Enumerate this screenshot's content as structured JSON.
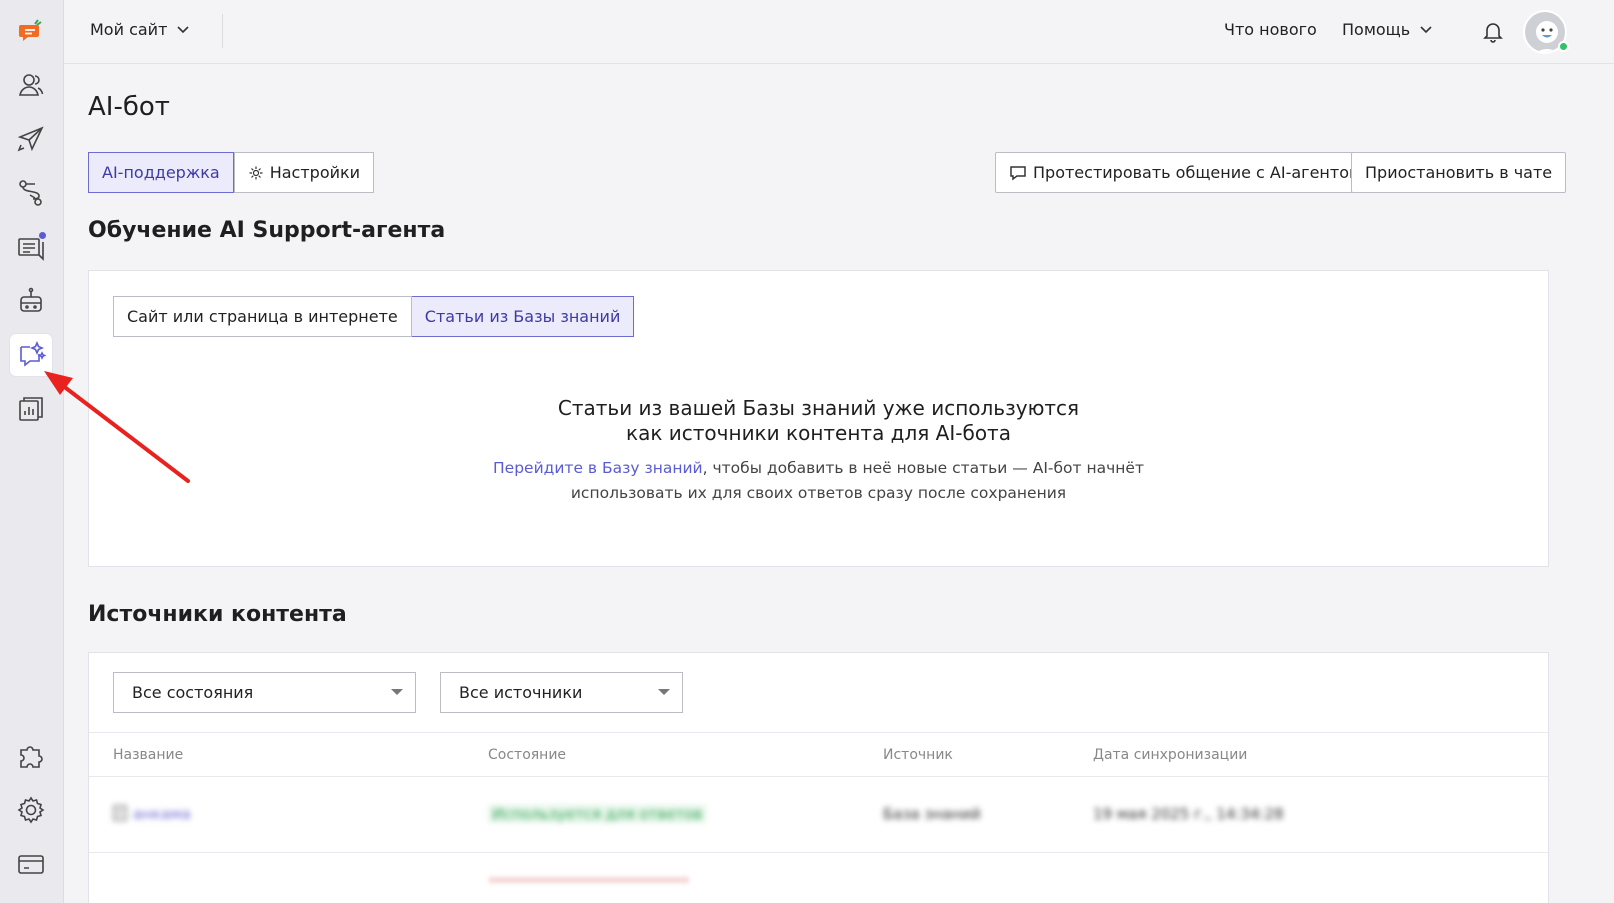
{
  "topbar": {
    "site": "Мой сайт",
    "whats_new": "Что нового",
    "help": "Помощь"
  },
  "page": {
    "title": "AI-бот",
    "tabs": [
      {
        "label": "AI-поддержка",
        "active": true
      },
      {
        "label": "Настройки",
        "active": false
      }
    ],
    "test_button": "Протестировать общение с AI-агентом",
    "pause_button": "Приостановить в чате"
  },
  "training": {
    "title": "Обучение AI Support-агента",
    "source_tabs": [
      {
        "label": "Сайт или страница в интернете",
        "active": false
      },
      {
        "label": "Статьи из Базы знаний",
        "active": true
      }
    ],
    "empty_title_line1": "Статьи из вашей Базы знаний уже используются",
    "empty_title_line2": "как источники контента для AI-бота",
    "link_text": "Перейдите в Базу знаний",
    "text_after_link": ", чтобы добавить в неё новые статьи — AI-бот начнёт",
    "text_line2": "использовать их для своих ответов сразу после сохранения"
  },
  "sources": {
    "title": "Источники контента",
    "filter_state": "Все состояния",
    "filter_source": "Все источники",
    "columns": [
      "Название",
      "Состояние",
      "Источник",
      "Дата синхронизации"
    ],
    "rows": [
      {
        "name": "анкама",
        "state": "Используется для ответов",
        "source": "База знаний",
        "date": "19 мая 2025 г., 14:34:28"
      }
    ]
  },
  "colors": {
    "accent": "#5b5bd6",
    "active_tab_bg": "#ecebfb",
    "logo": "#f26b22",
    "arrow": "#e8231f"
  },
  "sidebar_icons": [
    "logo-icon",
    "users-icon",
    "rocket-icon",
    "route-icon",
    "chats-icon",
    "robot-icon",
    "ai-chat-icon",
    "reports-icon",
    "puzzle-icon",
    "gear-icon",
    "card-icon"
  ]
}
